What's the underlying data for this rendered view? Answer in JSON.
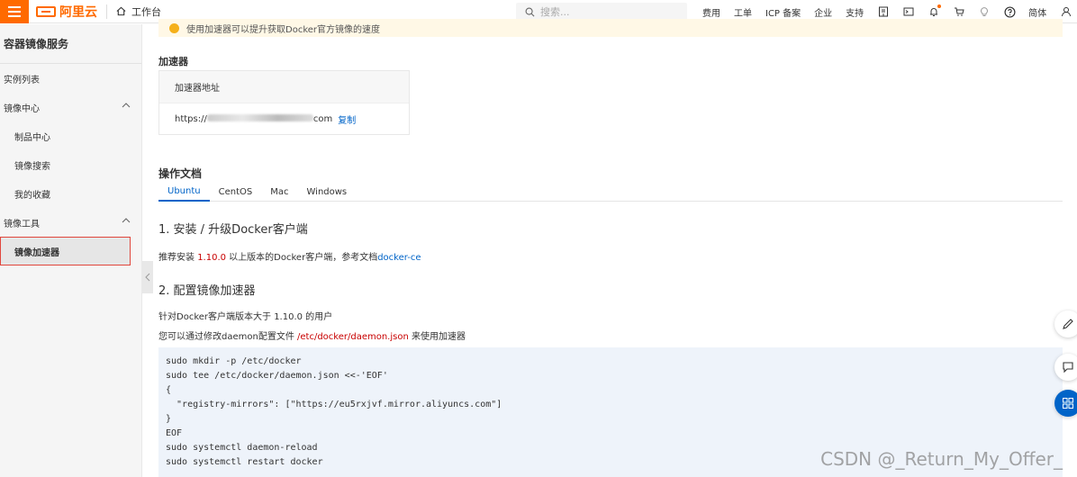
{
  "topbar": {
    "logo_text": "阿里云",
    "workbench": "工作台",
    "search_placeholder": "搜索...",
    "nav": [
      "费用",
      "工单",
      "ICP 备案",
      "企业",
      "支持"
    ],
    "lang": "简体"
  },
  "sidebar": {
    "title": "容器镜像服务",
    "items": [
      {
        "label": "实例列表"
      },
      {
        "label": "镜像中心"
      },
      {
        "label": "制品中心"
      },
      {
        "label": "镜像搜索"
      },
      {
        "label": "我的收藏"
      },
      {
        "label": "镜像工具"
      },
      {
        "label": "镜像加速器"
      }
    ]
  },
  "main": {
    "notice": "使用加速器可以提升获取Docker官方镜像的速度",
    "accelerator_heading": "加速器",
    "accelerator_table_header": "加速器地址",
    "accelerator_url_prefix": "https://",
    "accelerator_url_suffix": "com",
    "copy_label": "复制",
    "docs_heading": "操作文档",
    "tabs": [
      "Ubuntu",
      "CentOS",
      "Mac",
      "Windows"
    ],
    "step1_title": "1. 安装 / 升级Docker客户端",
    "step1_text_a": "推荐安装 ",
    "step1_version": "1.10.0",
    "step1_text_b": " 以上版本的Docker客户端，参考文档",
    "step1_link": "docker-ce",
    "step2_title": "2. 配置镜像加速器",
    "step2_line1": "针对Docker客户端版本大于 1.10.0 的用户",
    "step2_line2_a": "您可以通过修改daemon配置文件 ",
    "step2_line2_path": "/etc/docker/daemon.json",
    "step2_line2_b": " 来使用加速器",
    "code_lines": [
      "sudo mkdir -p /etc/docker",
      "sudo tee /etc/docker/daemon.json <<-'EOF'",
      "{",
      "  \"registry-mirrors\": [\"https://eu5rxjvf.mirror.aliyuncs.com\"]",
      "}",
      "EOF",
      "sudo systemctl daemon-reload",
      "sudo systemctl restart docker"
    ]
  },
  "watermark": "CSDN @_Return_My_Offer_",
  "colors": {
    "brand": "#ff6a00",
    "link": "#0064c8",
    "active_outline": "#e0463c"
  }
}
